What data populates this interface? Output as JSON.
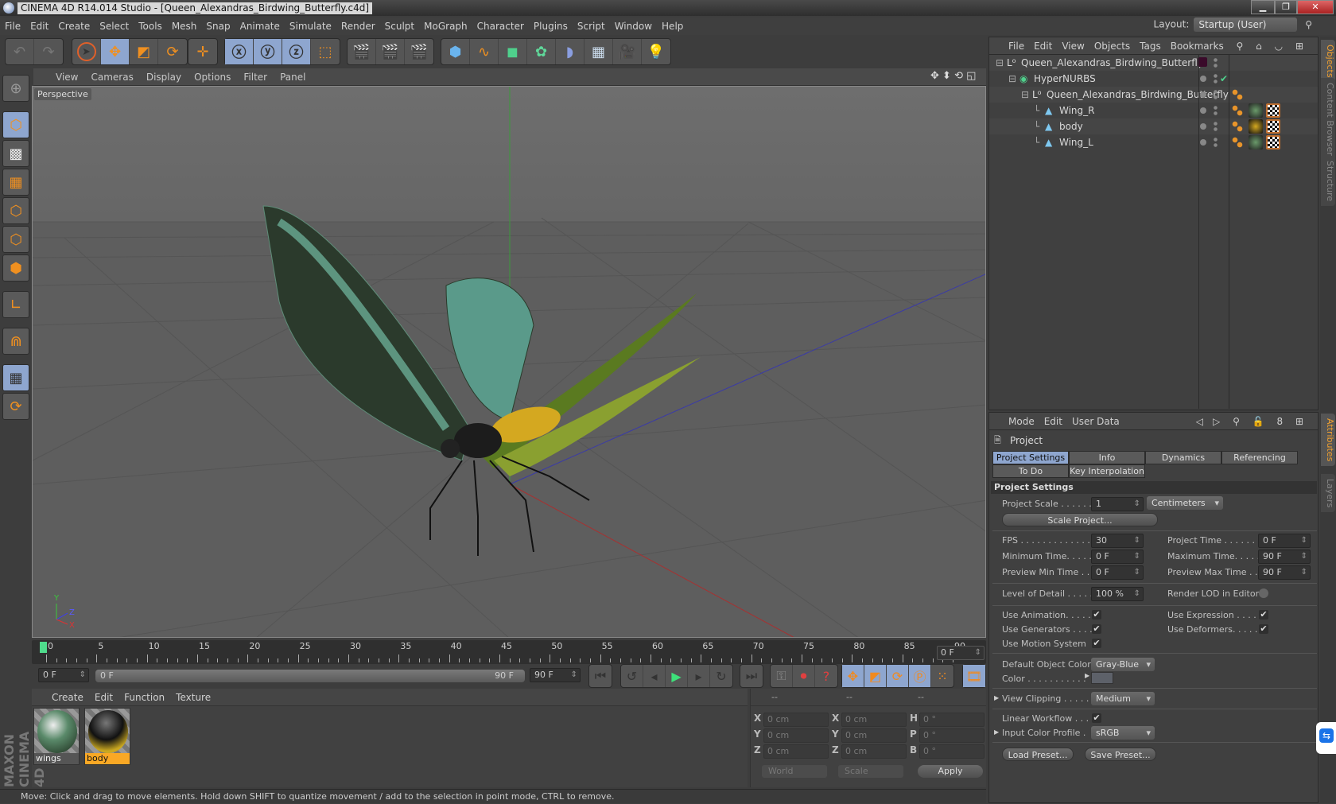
{
  "window": {
    "title": "CINEMA 4D R14.014 Studio - [Queen_Alexandras_Birdwing_Butterfly.c4d]",
    "controls": [
      "minimize",
      "restore",
      "close"
    ]
  },
  "menubar": [
    "File",
    "Edit",
    "Create",
    "Select",
    "Tools",
    "Mesh",
    "Snap",
    "Animate",
    "Simulate",
    "Render",
    "Sculpt",
    "MoGraph",
    "Character",
    "Plugins",
    "Script",
    "Window",
    "Help"
  ],
  "layout": {
    "label": "Layout:",
    "value": "Startup (User)"
  },
  "toolbar": {
    "groups": [
      [
        "undo-icon",
        "redo-icon"
      ],
      [
        "live-selection-icon",
        "move-icon",
        "scale-icon",
        "rotate-icon"
      ],
      [
        "recent-tool-icon"
      ],
      [
        "x-axis-icon",
        "y-axis-icon",
        "z-axis-icon",
        "coordinate-system-icon"
      ],
      [
        "render-view-icon",
        "render-picture-viewer-icon",
        "render-settings-icon"
      ],
      [
        "cube-icon",
        "spline-icon",
        "nurbs-icon",
        "array-icon",
        "deformer-icon",
        "floor-icon",
        "camera-icon",
        "light-icon"
      ]
    ]
  },
  "left_tools": [
    "make-editable-icon",
    "model-mode-icon",
    "texture-mode-icon",
    "workplane-icon",
    "points-mode-icon",
    "edges-mode-icon",
    "polygons-mode-icon",
    "axis-mode-icon",
    "snap-icon",
    "locked-workplane-icon",
    "planar-workplane-icon"
  ],
  "viewport": {
    "menu": [
      "View",
      "Cameras",
      "Display",
      "Options",
      "Filter",
      "Panel"
    ],
    "camera_label": "Perspective",
    "axis_labels": {
      "x": "X",
      "y": "Y",
      "z": "Z"
    }
  },
  "timeline": {
    "ticks": [
      "0",
      "5",
      "10",
      "15",
      "20",
      "25",
      "30",
      "35",
      "40",
      "45",
      "50",
      "55",
      "60",
      "65",
      "70",
      "75",
      "80",
      "85",
      "90"
    ],
    "current_frame": "0 F",
    "start_field": "0 F",
    "range_start": "0 F",
    "range_end": "90 F",
    "end_field": "90 F"
  },
  "material_manager": {
    "menu": [
      "Create",
      "Edit",
      "Function",
      "Texture"
    ],
    "materials": [
      {
        "name": "wings",
        "selected": false
      },
      {
        "name": "body",
        "selected": true
      }
    ],
    "brand": "MAXON CINEMA 4D"
  },
  "coordinates": {
    "headers": [
      "--",
      "--",
      "--"
    ],
    "rows": [
      {
        "a": "X",
        "v1": "0 cm",
        "b": "X",
        "v2": "0 cm",
        "c": "H",
        "v3": "0 °"
      },
      {
        "a": "Y",
        "v1": "0 cm",
        "b": "Y",
        "v2": "0 cm",
        "c": "P",
        "v3": "0 °"
      },
      {
        "a": "Z",
        "v1": "0 cm",
        "b": "Z",
        "v2": "0 cm",
        "c": "B",
        "v3": "0 °"
      }
    ],
    "mode1": "World",
    "mode2": "Scale",
    "apply": "Apply"
  },
  "status": "Move: Click and drag to move elements. Hold down SHIFT to quantize movement / add to the selection in point mode, CTRL to remove.",
  "object_manager": {
    "menu": [
      "File",
      "Edit",
      "View",
      "Objects",
      "Tags",
      "Bookmarks"
    ],
    "objects": [
      {
        "name": "Queen_Alexandras_Birdwing_Butterfly",
        "type": "null",
        "depth": 0
      },
      {
        "name": "HyperNURBS",
        "type": "hypernurbs",
        "depth": 1
      },
      {
        "name": "Queen_Alexandras_Birdwing_Butterfly",
        "type": "null",
        "depth": 2
      },
      {
        "name": "Wing_R",
        "type": "polygon",
        "depth": 3
      },
      {
        "name": "body",
        "type": "polygon",
        "depth": 3
      },
      {
        "name": "Wing_L",
        "type": "polygon",
        "depth": 3
      }
    ]
  },
  "side_tabs": {
    "top": [
      "Objects",
      "Content Browser",
      "Structure"
    ],
    "bottom": [
      "Attributes",
      "Layers"
    ]
  },
  "attributes": {
    "menu": [
      "Mode",
      "Edit",
      "User Data"
    ],
    "title": "Project",
    "tabs": [
      "Project Settings",
      "Info",
      "Dynamics",
      "Referencing",
      "To Do",
      "Key Interpolation"
    ],
    "active_tab": "Project Settings",
    "section": "Project Settings",
    "project_scale": {
      "label": "Project Scale . . . . . .",
      "value": "1",
      "unit": "Centimeters"
    },
    "scale_project_btn": "Scale Project...",
    "fps": {
      "label": "FPS . . . . . . . . . . . . . .",
      "value": "30"
    },
    "project_time": {
      "label": "Project Time . . . . . . . .",
      "value": "0 F"
    },
    "min_time": {
      "label": "Minimum Time. . . . .",
      "value": "0 F"
    },
    "max_time": {
      "label": "Maximum Time. . . . . .",
      "value": "90 F"
    },
    "preview_min": {
      "label": "Preview Min Time . .",
      "value": "0 F"
    },
    "preview_max": {
      "label": "Preview Max Time . . .",
      "value": "90 F"
    },
    "lod": {
      "label": "Level of Detail . . . . .",
      "value": "100 %"
    },
    "render_lod": {
      "label": "Render LOD in Editor",
      "checked": false
    },
    "use_animation": {
      "label": "Use Animation. . . . .",
      "checked": true
    },
    "use_expression": {
      "label": "Use Expression . . . . .",
      "checked": true
    },
    "use_generators": {
      "label": "Use Generators . . . .",
      "checked": true
    },
    "use_deformers": {
      "label": "Use Deformers. . . . . .",
      "checked": true
    },
    "use_motion": {
      "label": "Use Motion System",
      "checked": true
    },
    "default_color": {
      "label": "Default Object Color",
      "value": "Gray-Blue"
    },
    "color": {
      "label": "Color . . . . . . . . . . .",
      "swatch": "#5d6169"
    },
    "view_clipping": {
      "label": "View Clipping . . . . .",
      "value": "Medium"
    },
    "linear_workflow": {
      "label": "Linear Workflow . . .",
      "checked": true
    },
    "input_profile": {
      "label": "Input Color Profile .",
      "value": "sRGB"
    },
    "load_preset": "Load Preset...",
    "save_preset": "Save Preset..."
  },
  "colors": {
    "accent": "#8ea6cf",
    "orange": "#f09020",
    "playhead": "#4fdc8c",
    "selected_material": "#f9a825"
  }
}
